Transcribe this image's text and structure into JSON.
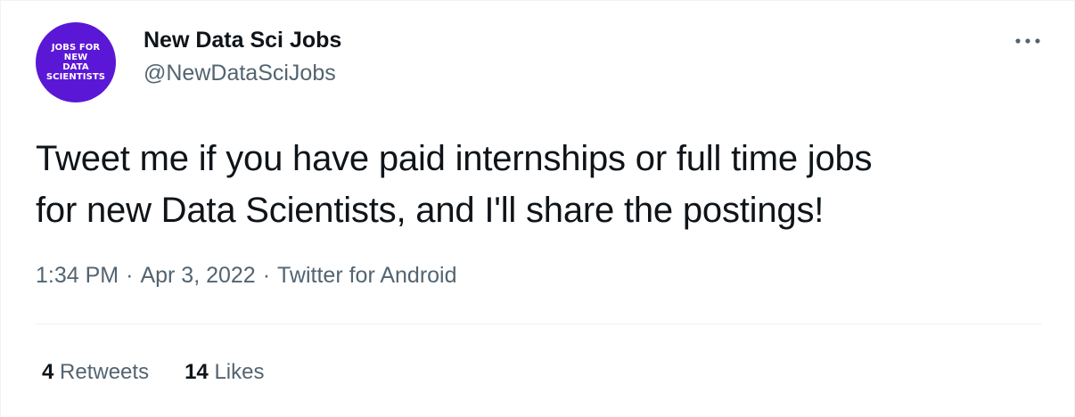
{
  "author": {
    "avatar_lines": [
      "JOBS FOR",
      "NEW",
      "DATA",
      "SCIENTISTS"
    ],
    "avatar_color": "#5b17d6",
    "display_name": "New Data Sci Jobs",
    "handle": "@NewDataSciJobs"
  },
  "more_icon": "more-horizontal-icon",
  "tweet": {
    "line1": "Tweet me if you have paid internships or full time jobs",
    "line2": "for new Data Scientists, and I'll share the postings!"
  },
  "meta": {
    "time": "1:34 PM",
    "separator": "·",
    "date": "Apr 3, 2022",
    "source": "Twitter for Android"
  },
  "stats": {
    "retweets_count": "4",
    "retweets_label": "Retweets",
    "likes_count": "14",
    "likes_label": "Likes"
  },
  "colors": {
    "text_primary": "#0f1419",
    "text_secondary": "#536471",
    "divider": "#eff3f4"
  }
}
